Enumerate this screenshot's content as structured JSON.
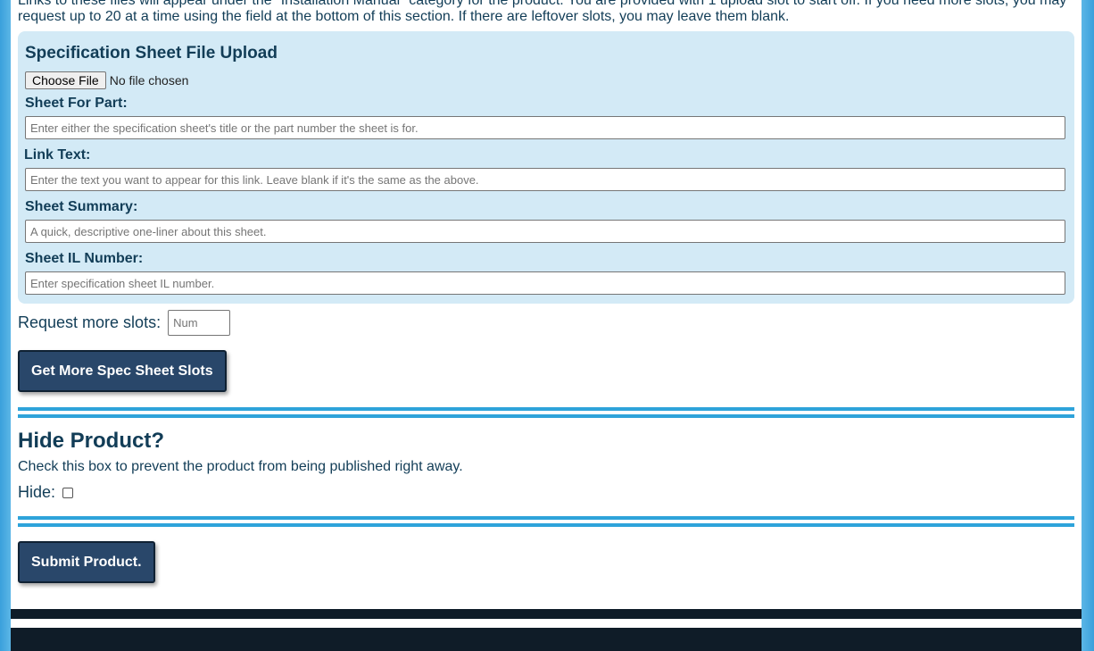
{
  "intro": {
    "line1": "Links to these files will appear under the \"Installation Manual\" category for the product. You are provided with 1 upload slot to start off. If you need more slots, you may",
    "line2": "request up to 20 at a time using the field at the bottom of this section. If there are leftover slots, you may leave them blank."
  },
  "spec_panel": {
    "title": "Specification Sheet File Upload",
    "choose_file_label": "Choose File",
    "no_file_text": "No file chosen",
    "sheet_for_part_label": "Sheet For Part:",
    "sheet_for_part_placeholder": "Enter either the specification sheet's title or the part number the sheet is for.",
    "link_text_label": "Link Text:",
    "link_text_placeholder": "Enter the text you want to appear for this link. Leave blank if it's the same as the above.",
    "sheet_summary_label": "Sheet Summary:",
    "sheet_summary_placeholder": "A quick, descriptive one-liner about this sheet.",
    "sheet_il_label": "Sheet IL Number:",
    "sheet_il_placeholder": "Enter specification sheet IL number."
  },
  "request_slots": {
    "label": "Request more slots:",
    "placeholder": "Num",
    "button": "Get More Spec Sheet Slots"
  },
  "hide_section": {
    "title": "Hide Product?",
    "description": "Check this box to prevent the product from being published right away.",
    "checkbox_label": "Hide:",
    "checked": false
  },
  "submit": {
    "button": "Submit Product."
  },
  "colors": {
    "accent": "#2ea3da",
    "button_bg": "#29476a",
    "panel_bg": "#d3eaf6",
    "text": "#123d57",
    "footer": "#0f1c28"
  }
}
